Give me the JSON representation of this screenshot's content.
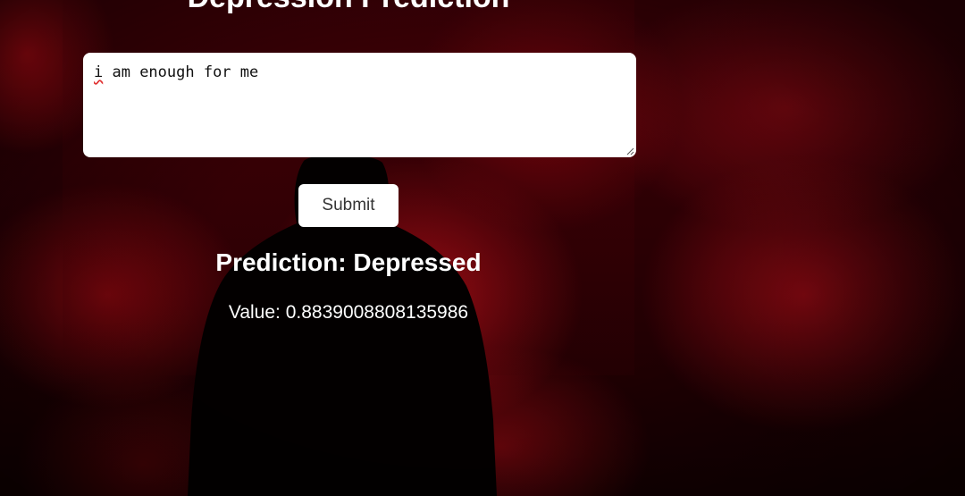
{
  "page": {
    "title": "Depression Prediction"
  },
  "form": {
    "input_first_word": "i",
    "input_rest": " am enough for me",
    "submit_label": "Submit"
  },
  "result": {
    "prediction_label": "Prediction:",
    "prediction_value": "Depressed",
    "value_label": "Value:",
    "value": "0.8839008808135986"
  },
  "colors": {
    "background_accent": "#b00010",
    "text": "#ffffff",
    "input_bg": "#ffffff",
    "button_text": "#333333"
  }
}
